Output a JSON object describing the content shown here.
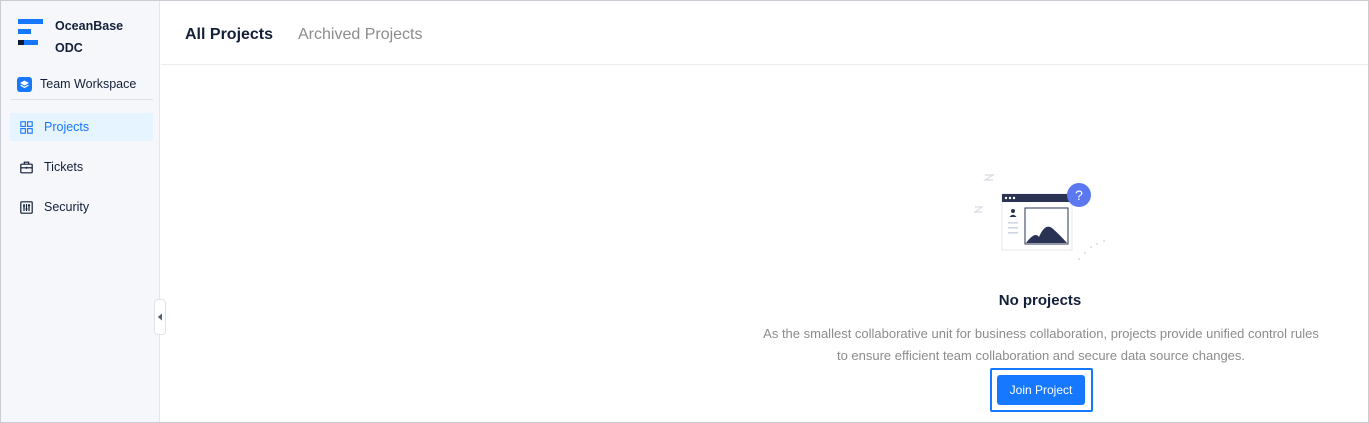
{
  "brand": {
    "line1": "OceanBase",
    "line2": "ODC"
  },
  "workspace": {
    "label": "Team Workspace",
    "icon": "layers-icon"
  },
  "sidebar": {
    "items": [
      {
        "label": "Projects",
        "icon": "grid-icon",
        "active": true
      },
      {
        "label": "Tickets",
        "icon": "briefcase-icon",
        "active": false
      },
      {
        "label": "Security",
        "icon": "sliders-icon",
        "active": false
      }
    ],
    "collapse_icon": "caret-left-icon"
  },
  "tabs": [
    {
      "label": "All Projects",
      "active": true
    },
    {
      "label": "Archived Projects",
      "active": false
    }
  ],
  "empty_state": {
    "illustration": "empty-projects-illustration",
    "badge": "?",
    "title": "No projects",
    "description_line1": "As the smallest collaborative unit for business collaboration, projects provide unified control rules",
    "description_line2": "to ensure efficient team collaboration and secure data source changes.",
    "button_label": "Join Project"
  },
  "colors": {
    "accent": "#1677ff",
    "sidebar_bg": "#f5f7fa",
    "active_item_bg": "#e6f4ff",
    "text_primary": "#132039",
    "text_secondary": "#8c8c8c",
    "illustration_dark": "#2a3353",
    "badge": "#5b78f0"
  }
}
